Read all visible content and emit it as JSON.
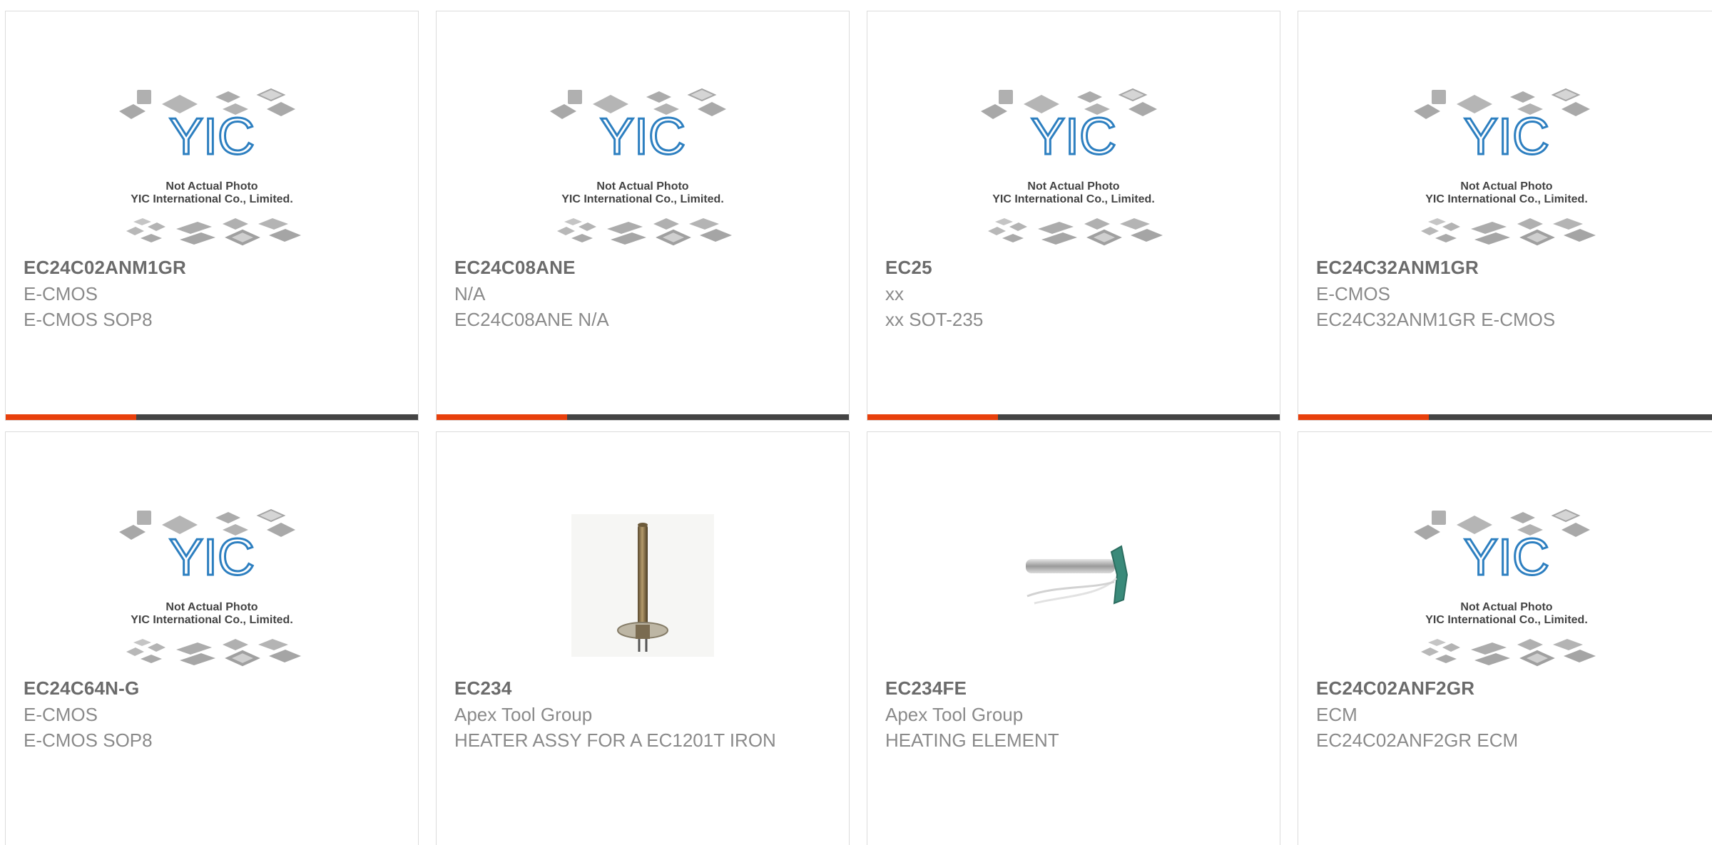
{
  "theme": {
    "accent": "#e8400c",
    "bar": "#444444"
  },
  "placeholder": {
    "line1": "Not Actual Photo",
    "line2": "YIC International Co., Limited.",
    "logo_text": "YIC"
  },
  "products": [
    {
      "part": "EC24C02ANM1GR",
      "manufacturer": "E-CMOS",
      "description": "E-CMOS SOP8",
      "image": "yic-placeholder"
    },
    {
      "part": "EC24C08ANE",
      "manufacturer": "N/A",
      "description": "EC24C08ANE N/A",
      "image": "yic-placeholder"
    },
    {
      "part": "EC25",
      "manufacturer": "xx",
      "description": "xx SOT-235",
      "image": "yic-placeholder"
    },
    {
      "part": "EC24C32ANM1GR",
      "manufacturer": "E-CMOS",
      "description": "EC24C32ANM1GR E-CMOS",
      "image": "yic-placeholder"
    },
    {
      "part": "EC24C64N-G",
      "manufacturer": "E-CMOS",
      "description": "E-CMOS SOP8",
      "image": "yic-placeholder"
    },
    {
      "part": "EC234",
      "manufacturer": "Apex Tool Group",
      "description": "HEATER ASSY FOR A EC1201T IRON",
      "image": "heater-assembly-photo"
    },
    {
      "part": "EC234FE",
      "manufacturer": "Apex Tool Group",
      "description": "HEATING ELEMENT",
      "image": "heating-element-photo"
    },
    {
      "part": "EC24C02ANF2GR",
      "manufacturer": "ECM",
      "description": "EC24C02ANF2GR ECM",
      "image": "yic-placeholder"
    }
  ]
}
